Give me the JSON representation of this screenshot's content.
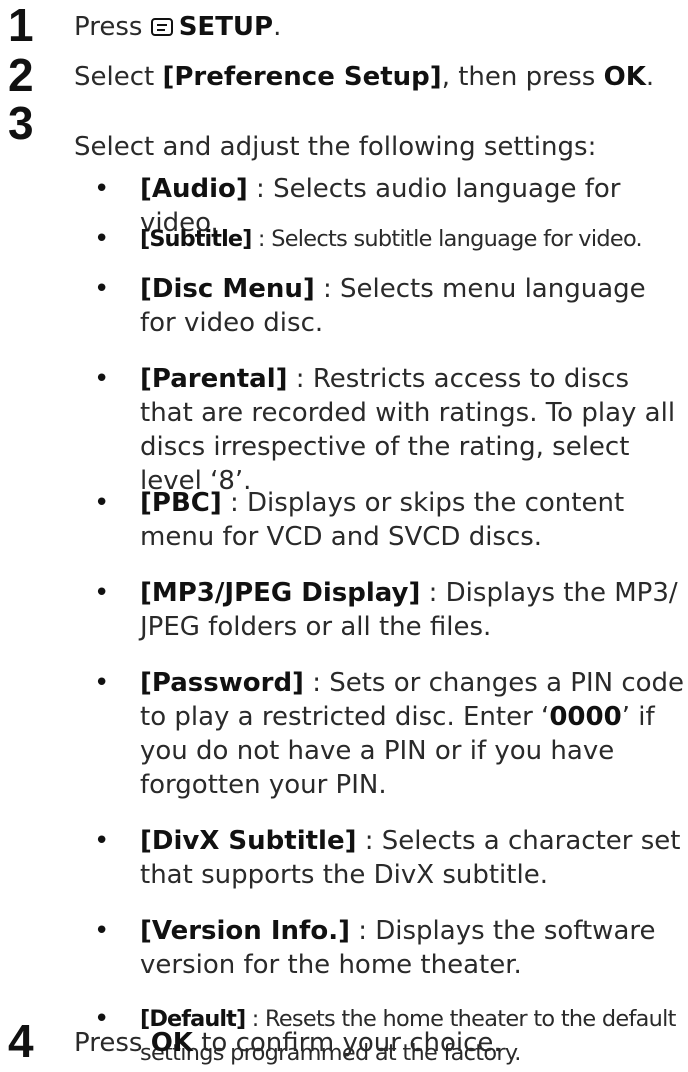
{
  "steps": [
    {
      "num": "1",
      "text_before": "Press ",
      "icon": "setup-menu-icon",
      "bold": "SETUP",
      "text_after": "."
    },
    {
      "num": "2",
      "text_before": "Select ",
      "bold": "[Preference Setup]",
      "text_middle": ", then press ",
      "bold2": "OK",
      "text_after": "."
    },
    {
      "num": "3",
      "text": "Select and adjust the following settings:"
    },
    {
      "num": "4",
      "text_before": "Press ",
      "bold": "OK",
      "text_after": " to confirm your choice."
    }
  ],
  "bullet_char": "•",
  "settings": [
    {
      "label": "[Audio]",
      "desc": " : Selects audio language for video."
    },
    {
      "label": "[Subtitle]",
      "desc": " : Selects subtitle language for video."
    },
    {
      "label": "[Disc Menu]",
      "desc": " : Selects menu language for video disc."
    },
    {
      "label": "[Parental]",
      "desc": " : Restricts access to discs that are recorded with ratings. To play all discs irrespective of the rating, select level ‘8’."
    },
    {
      "label": "[PBC]",
      "desc": " : Displays or skips the content menu for VCD and SVCD discs."
    },
    {
      "label": "[MP3/JPEG Display]",
      "desc": " : Displays the MP3/ JPEG folders or all the files."
    },
    {
      "label": "[Password]",
      "desc_before": " : Sets or changes a PIN code to play a restricted disc. Enter ‘",
      "bold": "0000",
      "desc_after": "’ if you do not have a PIN or if you have forgotten your PIN."
    },
    {
      "label": "[DivX Subtitle]",
      "desc": " : Selects a character set that supports the DivX subtitle."
    },
    {
      "label": "[Version Info.]",
      "desc": " : Displays the software version for the home theater."
    },
    {
      "label": "[Default]",
      "desc": " : Resets the home theater to the default settings programmed at the factory."
    }
  ]
}
